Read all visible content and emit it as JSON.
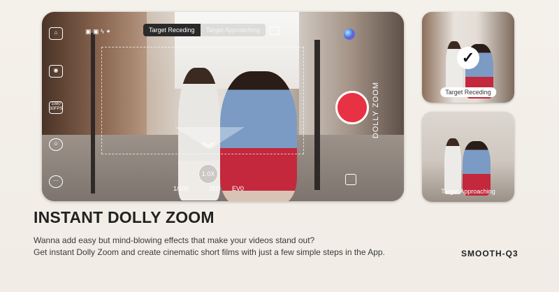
{
  "camera": {
    "mode_tabs": [
      {
        "label": "Target Receding",
        "active": true
      },
      {
        "label": "Target Approaching",
        "active": false
      }
    ],
    "left_icons": [
      "home-icon",
      "camera-switch-icon",
      "resolution-icon",
      "face-track-icon",
      "more-icon"
    ],
    "resolution_label": "1080 30FPS",
    "zoom_label": "1.0X",
    "side_label": "DOLLY ZOOM",
    "shutter_readout": "1/100",
    "iso_readout": "ISO",
    "ev_readout": "EV0",
    "record_color": "#e83143"
  },
  "thumbnails": [
    {
      "label": "Target Receding",
      "selected": true
    },
    {
      "label": "Target Approaching",
      "selected": false
    }
  ],
  "title": "INSTANT DOLLY ZOOM",
  "description": [
    "Wanna add easy but mind-blowing effects that make your videos stand out?",
    "Get instant Dolly Zoom and create cinematic short films with just a few simple steps in the App."
  ],
  "brand": "SMOOTH-Q3"
}
